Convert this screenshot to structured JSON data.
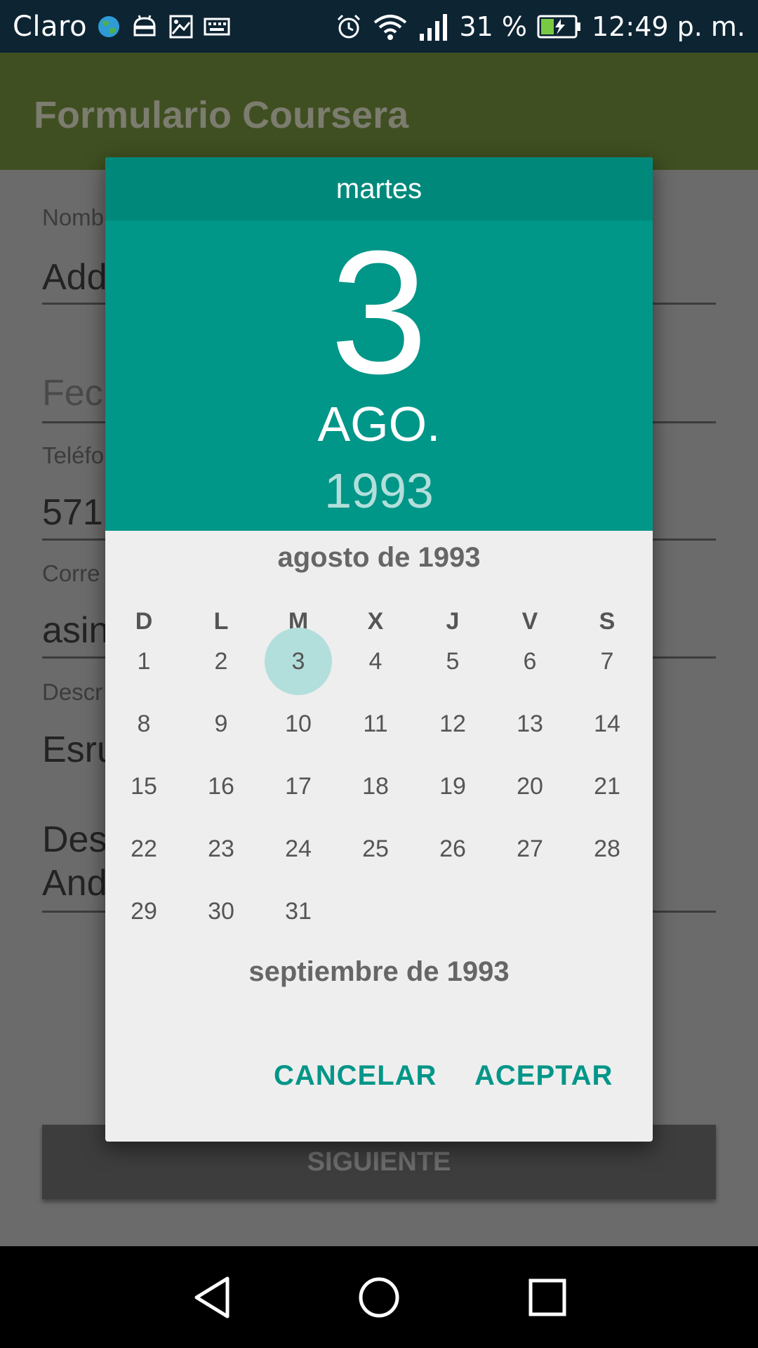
{
  "status_bar": {
    "carrier": "Claro",
    "battery_percent": "31 %",
    "time": "12:49 p. m.",
    "icons": [
      "globe-icon",
      "android-icon",
      "image-icon",
      "keyboard-icon",
      "alarm-icon",
      "wifi-icon",
      "signal-icon",
      "battery-icon"
    ]
  },
  "app": {
    "title": "Formulario Coursera",
    "fields": [
      {
        "label": "Nomb",
        "value": "Add"
      },
      {
        "label": "",
        "value": "Fecl"
      },
      {
        "label": "Teléfo",
        "value": "571"
      },
      {
        "label": "Corre",
        "value": "asin"
      },
      {
        "label": "Descr",
        "value": "Esru"
      },
      {
        "label": "",
        "value": "Des\nAnd"
      }
    ],
    "next_button": "SIGUIENTE"
  },
  "date_picker": {
    "weekday_name": "martes",
    "day": "3",
    "month_short": "AGO.",
    "year": "1993",
    "current_month_title": "agosto de 1993",
    "next_month_title": "septiembre de 1993",
    "weekdays": [
      "D",
      "L",
      "M",
      "X",
      "J",
      "V",
      "S"
    ],
    "first_weekday_index": 0,
    "days_in_month": 31,
    "selected_day": 3,
    "cancel_label": "CANCELAR",
    "ok_label": "ACEPTAR",
    "accent_color": "#009688"
  },
  "nav_bar": {
    "icons": [
      "back-icon",
      "home-icon",
      "recents-icon"
    ]
  }
}
